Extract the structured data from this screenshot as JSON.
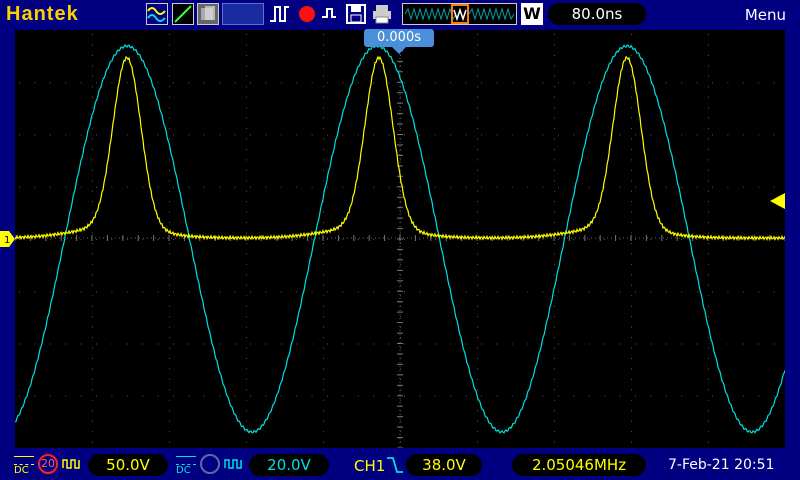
{
  "brand": "Hantek",
  "toolbar": {
    "timebase": "80.0ns",
    "menu_label": "Menu",
    "trigger_mode_letter": "W",
    "time_offset": "0.000s"
  },
  "icons": {
    "signal": "waveform-icon",
    "cursor": "cursor-icon",
    "persist": "persistence-icon",
    "pulse": "pulse-icon",
    "record": "record-icon",
    "save": "save-icon",
    "print": "print-icon",
    "trigger_level": "trigger-level-marker-icon",
    "ch1_marker": "channel-1-marker-icon"
  },
  "colors": {
    "ch1": "#ffff00",
    "ch2": "#00e0e0",
    "bar": "#000080",
    "accent": "#ff8000"
  },
  "ch1": {
    "coupling": "DC",
    "probe": "20",
    "volts_div": "50.0V"
  },
  "ch2": {
    "coupling": "DC",
    "volts_div": "20.0V"
  },
  "trigger": {
    "source": "CH1",
    "level": "38.0V"
  },
  "frequency": "2.05046MHz",
  "datetime": "7-Feb-21 20:51"
}
